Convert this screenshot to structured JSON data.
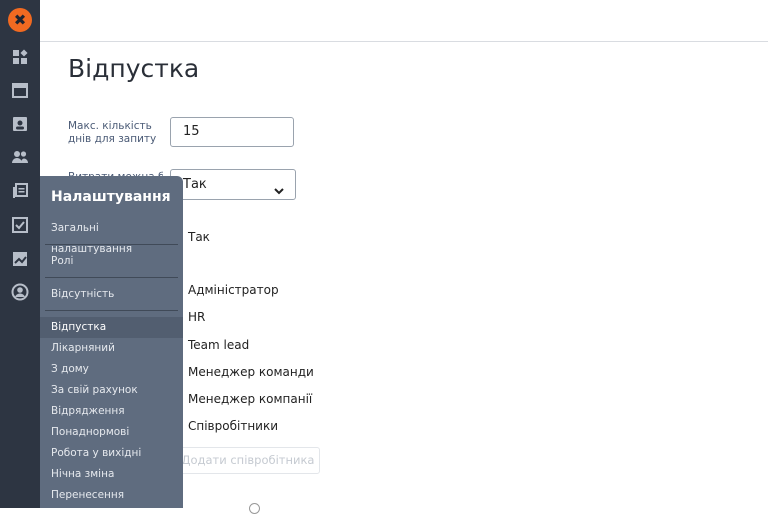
{
  "app": {
    "logo_glyph": "✖"
  },
  "rail": {
    "icons": [
      "dashboard-icon",
      "calendar-icon",
      "contacts-book-icon",
      "people-icon",
      "documents-icon",
      "checklist-icon",
      "chart-icon",
      "account-circle-icon"
    ]
  },
  "page": {
    "title": "Відпустка"
  },
  "form": {
    "max_days_label": "Макс. кількість днів для запиту",
    "max_days_value": "15",
    "select_label_partial": "Витрати можна б...",
    "select_value": "Так",
    "static_value": "Так"
  },
  "roles": [
    "Адміністратор",
    "HR",
    "Team lead",
    "Менеджер команди",
    "Менеджер компанії",
    "Співробітники"
  ],
  "add_employee_label": "Додати співробітника",
  "menu": {
    "title": "Налаштування",
    "top_items": [
      "Загальні налаштування",
      "Ролі",
      "Відсутність"
    ],
    "leave_items": [
      "Відпустка",
      "Лікарняний",
      "З дому",
      "За свій рахунок",
      "Відрядження",
      "Понаднормові",
      "Робота у вихідні",
      "Нічна зміна",
      "Перенесення"
    ],
    "active": "Відпустка"
  },
  "colors": {
    "accent": "#f16a21",
    "rail": "#2d3542",
    "menu": "#5f6c7f"
  }
}
